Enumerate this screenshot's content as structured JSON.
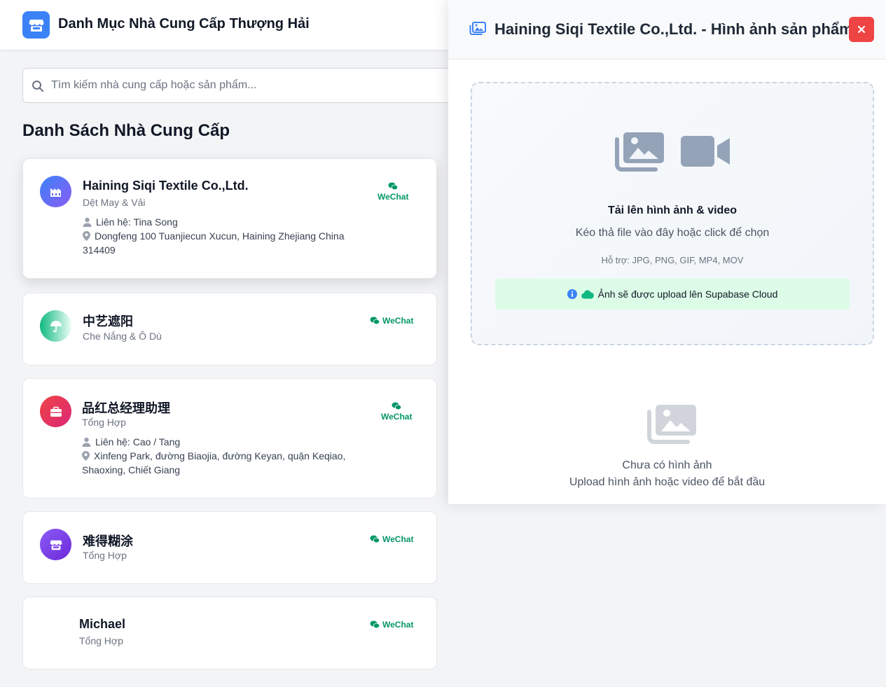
{
  "header": {
    "app_title": "Danh Mục Nhà Cung Cấp Thượng Hải",
    "logo_icon": "store-icon",
    "accent_color": "#3b82f6"
  },
  "search": {
    "placeholder": "Tìm kiếm nhà cung cấp hoặc sản phẩm...",
    "value": ""
  },
  "main": {
    "section_title": "Danh Sách Nhà Cung Cấp"
  },
  "suppliers": [
    {
      "name": "Haining Siqi Textile Co.,Ltd.",
      "category": "Dệt May & Vải",
      "contact": "Liên hệ: Tina Song",
      "address": "Dongfeng 100 Tuanjiecun Xucun, Haining Zhejiang China 314409",
      "wechat_label": "WeChat",
      "icon": "factory-icon",
      "selected": true
    },
    {
      "name": "中艺遮阳",
      "category": "Che Nắng & Ô Dù",
      "wechat_label": "WeChat",
      "icon": "umbrella-icon"
    },
    {
      "name": "品红总经理助理",
      "category": "Tổng Hợp",
      "contact": "Liên hệ: Cao / Tang",
      "address": "Xinfeng Park, đường Biaojia, đường Keyan, quận Keqiao, Shaoxing, Chiết Giang",
      "wechat_label": "WeChat",
      "icon": "briefcase-icon"
    },
    {
      "name": "难得糊涂",
      "category": "Tổng Hợp",
      "wechat_label": "WeChat",
      "icon": "store-icon"
    },
    {
      "name": "Michael",
      "category": "Tổng Hợp",
      "wechat_label": "WeChat"
    }
  ],
  "panel": {
    "title": "Haining Siqi Textile Co.,Ltd. - Hình ảnh sản phẩm",
    "title_icon": "images-icon",
    "close_icon": "close-icon",
    "upload": {
      "title": "Tải lên hình ảnh & video",
      "subtitle": "Kéo thả file vào đây hoặc click để chọn",
      "formats": "Hỗ trợ: JPG, PNG, GIF, MP4, MOV",
      "notice": "Ảnh sẽ được upload lên Supabase Cloud",
      "icons": [
        "images-icon",
        "video-icon"
      ]
    },
    "empty": {
      "title": "Chưa có hình ảnh",
      "subtitle": "Upload hình ảnh hoặc video để bắt đầu"
    }
  },
  "colors": {
    "wechat_green": "#059669",
    "close_red": "#ef4444",
    "notice_bg": "#dcfce7"
  }
}
